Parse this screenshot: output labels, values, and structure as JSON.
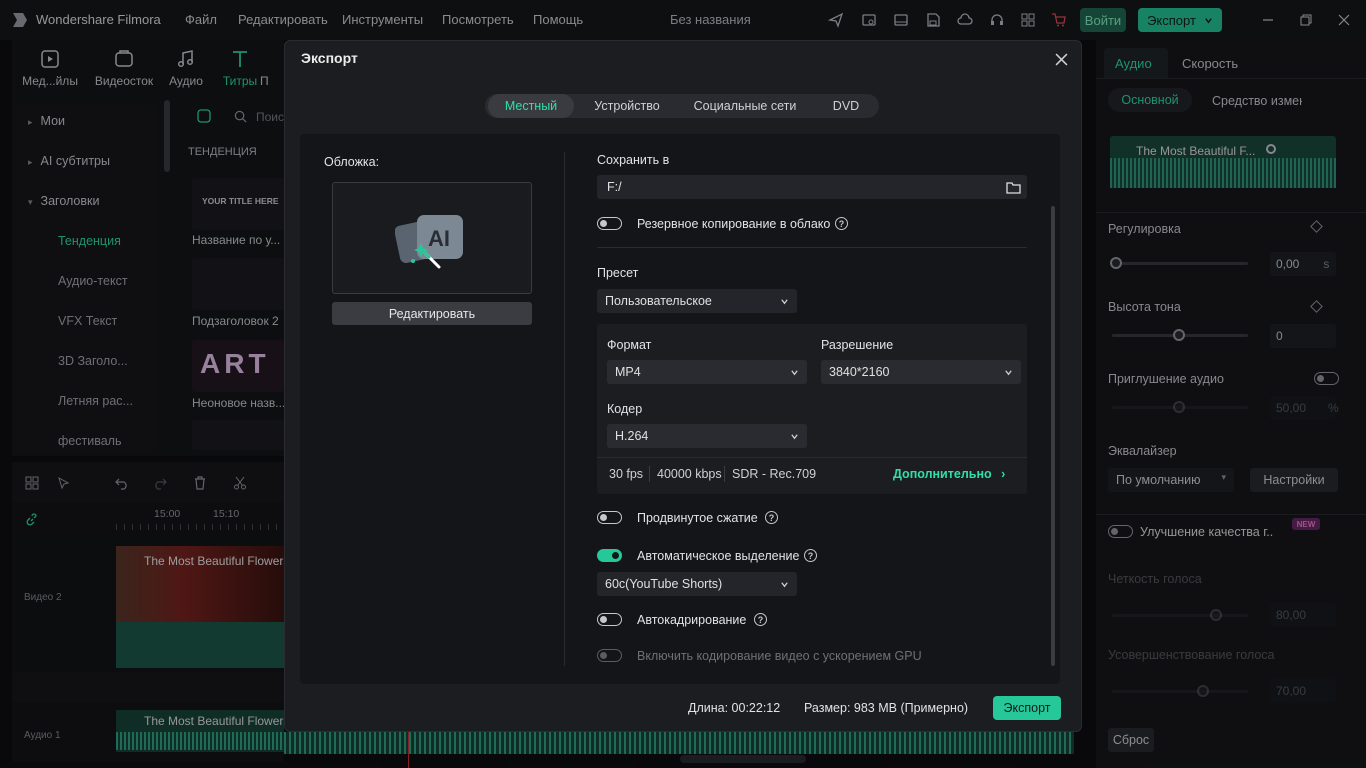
{
  "app": {
    "name": "Wondershare Filmora",
    "menus": [
      "Файл",
      "Редактировать",
      "Инструменты",
      "Посмотреть",
      "Помощь"
    ],
    "project_title": "Без названия",
    "login_label": "Войти",
    "export_label": "Экспорт",
    "accent": "#26c89a"
  },
  "left_panel": {
    "toolbar": [
      "Мед...йлы",
      "Видеосток",
      "Аудио",
      "Титры",
      "П"
    ],
    "search_placeholder": "Поис",
    "tree": [
      "Мои",
      "AI субтитры",
      "Заголовки"
    ],
    "sub_items": [
      "Тенденция",
      "Аудио-текст",
      "VFX Текст",
      "3D Заголо...",
      "Летняя рас...",
      "фестиваль"
    ],
    "section_label": "ТЕНДЕНЦИЯ",
    "thumbs": [
      {
        "caption": "YOUR TITLE HERE",
        "label": "Название по у..."
      },
      {
        "caption": "",
        "label": "Подзаголовок 2"
      },
      {
        "caption": "ART",
        "label": "Неоновое назв..."
      }
    ]
  },
  "timeline": {
    "ticks": [
      "15:00",
      "15:10"
    ],
    "tracks": [
      "Видео 2",
      "Аудио 1"
    ],
    "video_clip": "The Most Beautiful Flowers",
    "audio_clip": "The Most Beautiful Flowers"
  },
  "right_panel": {
    "tabs": [
      "Аудио",
      "Скорость"
    ],
    "subtabs": [
      "Основной",
      "Средство измен"
    ],
    "clip_name": "The Most Beautiful F...",
    "adjust_label": "Регулировка",
    "adjust_value": "0,00",
    "adjust_unit": "s",
    "pitch_label": "Высота тона",
    "pitch_value": "0",
    "ducking_label": "Приглушение аудио",
    "ducking_value": "50,00",
    "ducking_unit": "%",
    "eq_label": "Эквалайзер",
    "eq_preset": "По умолчанию",
    "eq_settings": "Настройки",
    "enhance_label": "Улучшение качества г..",
    "new_badge": "NEW",
    "clarity_label": "Четкость голоса",
    "clarity_value": "80,00",
    "voice_improve_label": "Усовершенствование голоса",
    "voice_improve_value": "70,00",
    "reset_label": "Сброс"
  },
  "dialog": {
    "title": "Экспорт",
    "tabs": [
      "Местный",
      "Устройство",
      "Социальные сети",
      "DVD"
    ],
    "active_tab": 0,
    "cover_label": "Обложка:",
    "edit_label": "Редактировать",
    "save_to_label": "Сохранить в",
    "save_path": "F:/",
    "cloud_backup_label": "Резервное копирование в облако",
    "preset_label": "Пресет",
    "preset_value": "Пользовательское",
    "format_label": "Формат",
    "format_value": "MP4",
    "resolution_label": "Разрешение",
    "resolution_value": "3840*2160",
    "codec_label": "Кодер",
    "codec_value": "H.264",
    "fps": "30 fps",
    "bitrate": "40000 kbps",
    "color_space": "SDR - Rec.709",
    "advanced_label": "Дополнительно",
    "advanced_compress_label": "Продвинутое сжатие",
    "auto_highlight_label": "Автоматическое выделение",
    "auto_highlight_value": "60с(YouTube Shorts)",
    "auto_reframe_label": "Автокадрирование",
    "gpu_label": "Включить кодирование видео с ускорением GPU",
    "duration_text": "Длина: 00:22:12",
    "size_text": "Размер: 983 MB (Примерно)",
    "export_button": "Экспорт"
  }
}
